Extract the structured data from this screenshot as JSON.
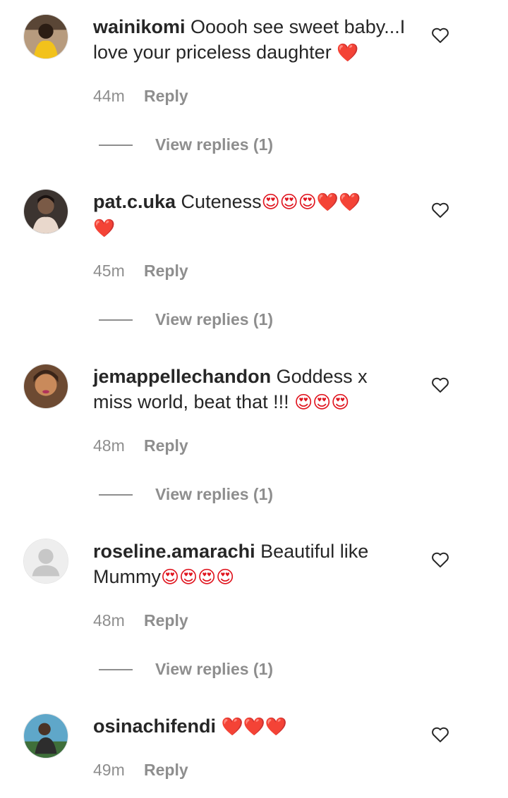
{
  "comments": [
    {
      "username": "wainikomi",
      "text_line1": " Ooooh see sweet baby...I",
      "text_line2": "love your priceless daughter ",
      "emoji2": "❤️",
      "time": "44m",
      "reply_label": "Reply",
      "view_replies": "View replies (1)",
      "avatar_colors": {
        "bg": "#b79b7e",
        "fg": "#f2c21b"
      }
    },
    {
      "username": "pat.c.uka",
      "text_line1": " Cuteness",
      "emoji1": "😍😍😍❤️❤️",
      "emoji2": "❤️",
      "time": "45m",
      "reply_label": "Reply",
      "view_replies": "View replies (1)",
      "avatar_colors": {
        "bg": "#3c3430",
        "fg": "#e9d8cc"
      }
    },
    {
      "username": "jemappellechandon",
      "text_line1": " Goddess x",
      "text_line2": "miss world, beat that !!! ",
      "emoji2": "😍😍😍",
      "time": "48m",
      "reply_label": "Reply",
      "view_replies": "View replies (1)",
      "avatar_colors": {
        "bg": "#6d4a32",
        "fg": "#c98a5b"
      }
    },
    {
      "username": "roseline.amarachi",
      "text_line1": " Beautiful like",
      "text_line2": "Mummy",
      "emoji2": "😍😍😍😍",
      "time": "48m",
      "reply_label": "Reply",
      "view_replies": "View replies (1)",
      "avatar_colors": {
        "bg": "#eeeeee",
        "fg": "#c7c7c7"
      }
    },
    {
      "username": "osinachifendi",
      "text_line1": " ",
      "emoji1": "❤️❤️❤️",
      "time": "49m",
      "reply_label": "Reply",
      "avatar_colors": {
        "bg": "#5fa7c9",
        "fg": "#2d2d2d"
      }
    }
  ],
  "icons": {
    "like": "heart-outline-icon"
  },
  "colors": {
    "text": "#262626",
    "muted": "#8e8e8e",
    "heart": "#e0141e"
  }
}
